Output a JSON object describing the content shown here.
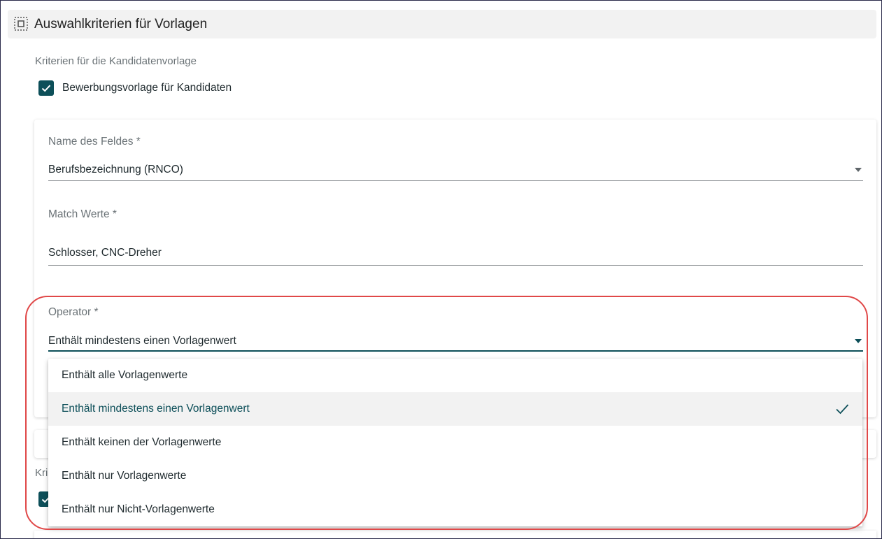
{
  "section": {
    "title": "Auswahlkriterien für Vorlagen",
    "icon": "select-all-icon"
  },
  "candidate_criteria": {
    "label": "Kriterien für die Kandidatenvorlage",
    "checkbox_label": "Bewerbungsvorlage für Kandidaten",
    "checked": true
  },
  "field_name": {
    "label": "Name des Feldes *",
    "value": "Berufsbezeichnung (RNCO)"
  },
  "match_values": {
    "label": "Match Werte *",
    "value": "Schlosser, CNC-Dreher"
  },
  "operator": {
    "label": "Operator *",
    "value": "Enthält mindestens einen Vorlagenwert",
    "options": [
      "Enthält alle Vorlagenwerte",
      "Enthält mindestens einen Vorlagenwert",
      "Enthält keinen der Vorlagenwerte",
      "Enthält nur Vorlagenwerte",
      "Enthält nur Nicht-Vorlagenwerte"
    ],
    "selected_index": 1
  },
  "partial_label": "Kri",
  "colors": {
    "accent": "#0d4f59",
    "highlight": "#e04848",
    "header_bg": "#f2f2f2"
  }
}
